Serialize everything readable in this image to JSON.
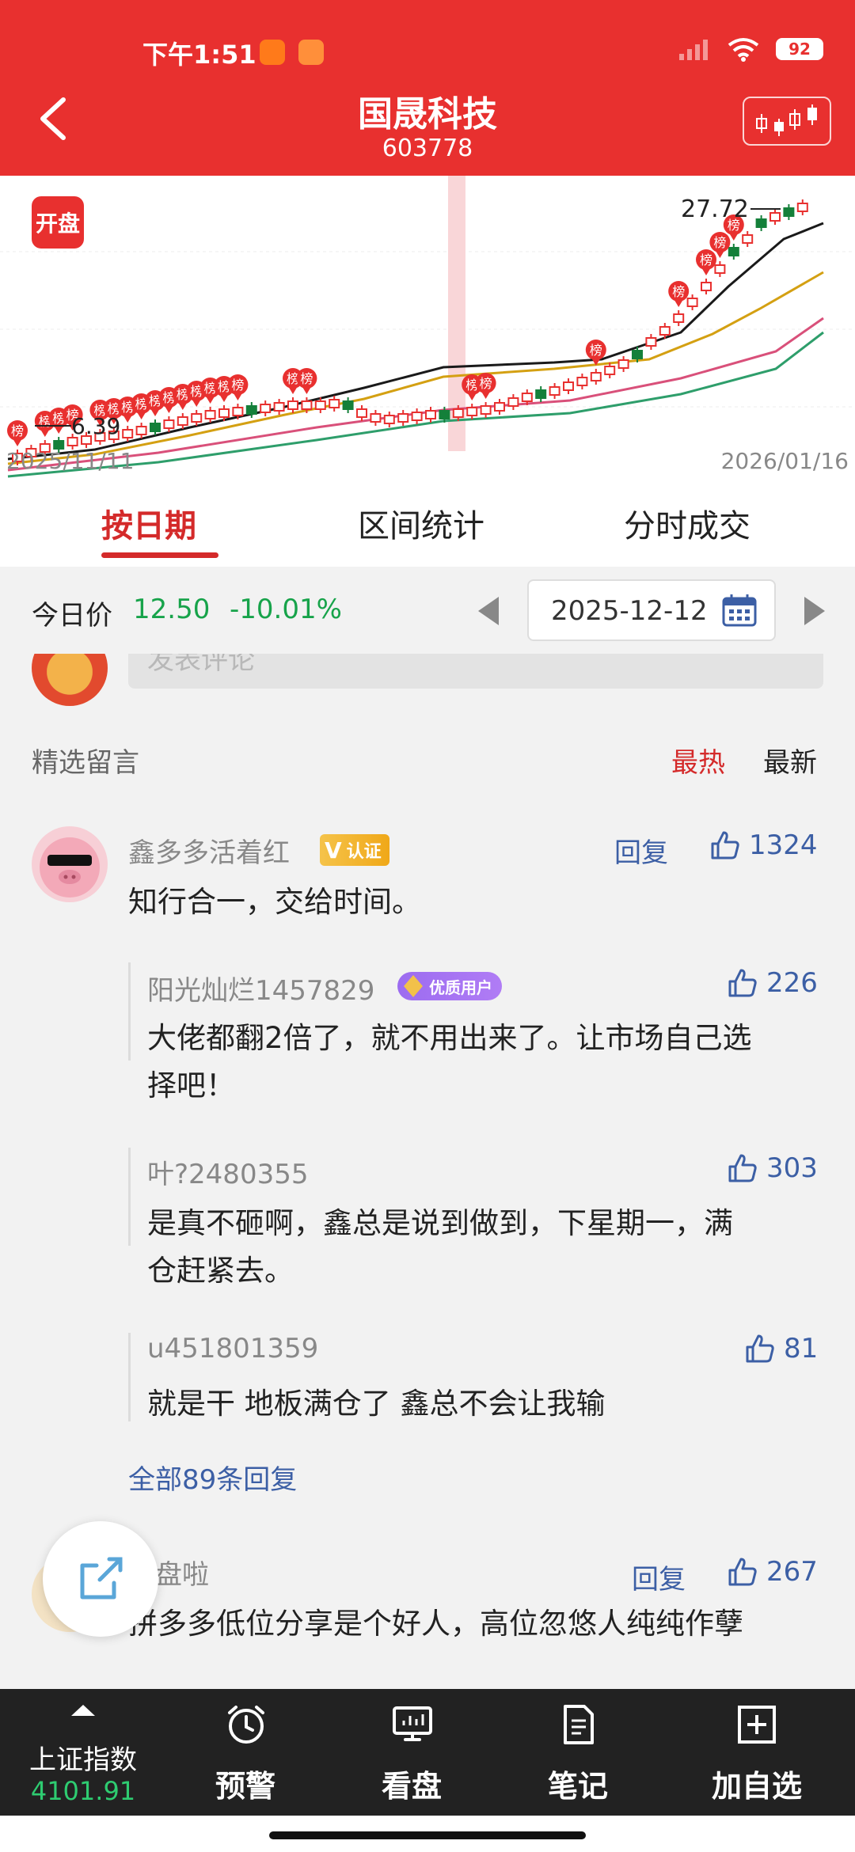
{
  "status": {
    "time": "下午1:51",
    "battery": "92"
  },
  "header": {
    "title": "国晟科技",
    "code": "603778"
  },
  "chart": {
    "open_badge": "开盘",
    "bang_label": "榜",
    "max_label": "27.72",
    "min_label": "6.39",
    "start_date": "2025/11/11",
    "end_date": "2026/01/16",
    "colors": {
      "up": "#e8302f",
      "down": "#14803a",
      "ma5": "#1a1a1a",
      "ma10": "#d4a012",
      "ma20": "#d9507a",
      "ma60": "#2e9e6b"
    }
  },
  "chart_data": {
    "type": "candlestick",
    "x_range": [
      "2025/11/11",
      "2026/01/16"
    ],
    "y_labels": {
      "max": 27.72,
      "min": 6.39
    }
  },
  "tabs": [
    {
      "label": "按日期",
      "active": true
    },
    {
      "label": "区间统计",
      "active": false
    },
    {
      "label": "分时成交",
      "active": false
    }
  ],
  "price_bar": {
    "label": "今日价",
    "price": "12.50",
    "change_pct": "-10.01%",
    "date": "2025-12-12"
  },
  "comments_section": {
    "placeholder": "发表评论",
    "title": "精选留言",
    "sort_hot": "最热",
    "sort_new": "最新",
    "reply_label": "回复",
    "main": {
      "user": "鑫多多活着红",
      "badge": "认证",
      "text": "知行合一，交给时间。",
      "likes": "1324"
    },
    "replies": [
      {
        "user": "阳光灿烂1457829",
        "badge": "优质用户",
        "text_line1": "大佬都翻2倍了，就不用出来了。让市场自己选",
        "text_line2": "择吧！",
        "likes": "226"
      },
      {
        "user": "叶?2480355",
        "text_line1": "是真不砸啊，鑫总是说到做到，下星期一，满",
        "text_line2": "仓赶紧去。",
        "likes": "303"
      },
      {
        "user": "u451801359",
        "text_line1": "就是干 地板满仓了 鑫总不会让我输",
        "likes": "81"
      }
    ],
    "more_replies": "全部89条回复",
    "second": {
      "user": "收盘啦",
      "text": "拼多多低位分享是个好人，高位忽悠人纯纯作孽",
      "likes": "267"
    }
  },
  "bottom_nav": {
    "index_name": "上证指数",
    "index_value": "4101.91",
    "items": [
      "预警",
      "看盘",
      "笔记",
      "加自选"
    ]
  }
}
